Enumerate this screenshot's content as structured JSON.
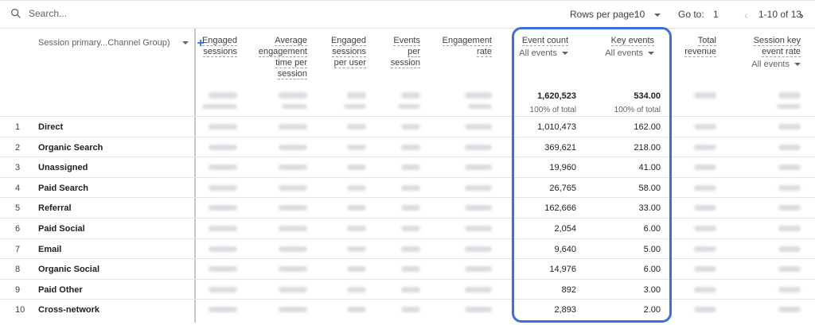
{
  "toolbar": {
    "search_placeholder": "Search...",
    "rows_per_page_label": "Rows per page:",
    "rows_per_page_value": "10",
    "goto_label": "Go to:",
    "goto_value": "1",
    "pagination_text": "1-10 of 13"
  },
  "header": {
    "dimension_label": "Session primary...Channel Group)",
    "columns": {
      "engaged_sessions": "Engaged sessions",
      "avg_engagement": "Average engagement time per session",
      "engaged_per_user": "Engaged sessions per user",
      "events_per_session": "Events per session",
      "engagement_rate": "Engagement rate",
      "event_count": "Event count",
      "key_events": "Key events",
      "total_revenue": "Total revenue",
      "session_key_event_rate": "Session key event rate"
    },
    "event_count_filter": "All events",
    "key_events_filter": "All events",
    "session_key_filter": "All events"
  },
  "totals": {
    "event_count": "1,620,523",
    "event_count_pct": "100% of total",
    "key_events": "534.00",
    "key_events_pct": "100% of total"
  },
  "rows": [
    {
      "num": "1",
      "channel": "Direct",
      "event_count": "1,010,473",
      "key_events": "162.00"
    },
    {
      "num": "2",
      "channel": "Organic Search",
      "event_count": "369,621",
      "key_events": "218.00"
    },
    {
      "num": "3",
      "channel": "Unassigned",
      "event_count": "19,960",
      "key_events": "41.00"
    },
    {
      "num": "4",
      "channel": "Paid Search",
      "event_count": "26,765",
      "key_events": "58.00"
    },
    {
      "num": "5",
      "channel": "Referral",
      "event_count": "162,666",
      "key_events": "33.00"
    },
    {
      "num": "6",
      "channel": "Paid Social",
      "event_count": "2,054",
      "key_events": "6.00"
    },
    {
      "num": "7",
      "channel": "Email",
      "event_count": "9,640",
      "key_events": "5.00"
    },
    {
      "num": "8",
      "channel": "Organic Social",
      "event_count": "14,976",
      "key_events": "6.00"
    },
    {
      "num": "9",
      "channel": "Paid Other",
      "event_count": "892",
      "key_events": "3.00"
    },
    {
      "num": "10",
      "channel": "Cross-network",
      "event_count": "2,893",
      "key_events": "2.00"
    }
  ],
  "colors": {
    "highlight": "#3b6fd6",
    "accent": "#1a73e8"
  }
}
